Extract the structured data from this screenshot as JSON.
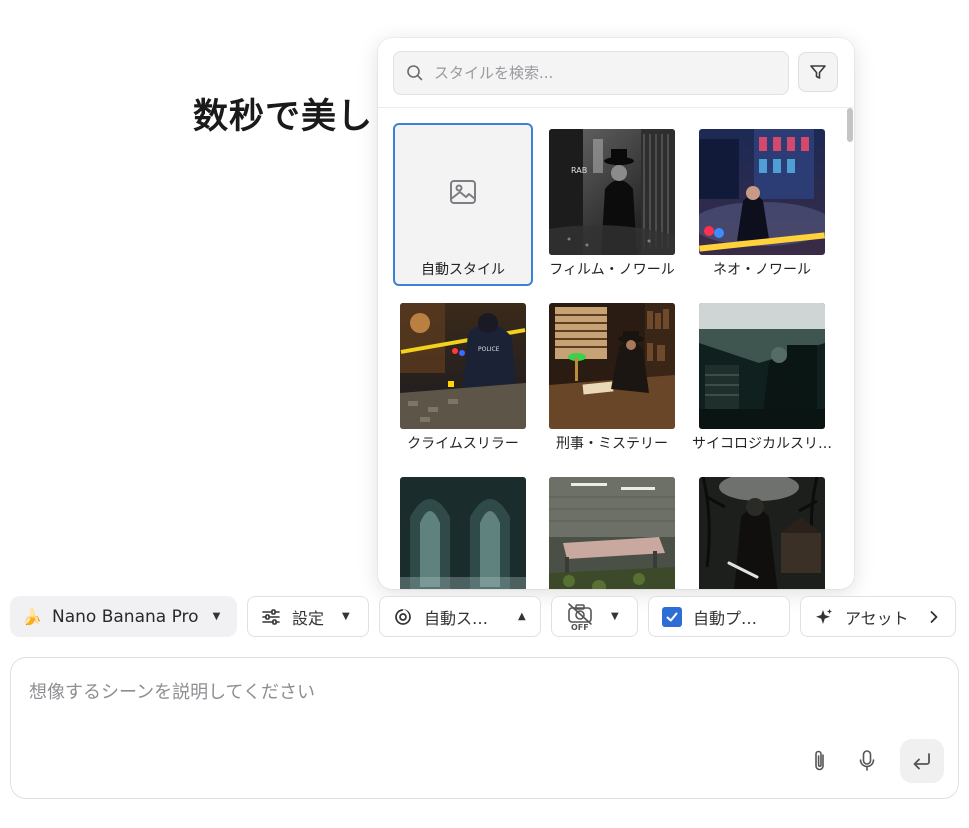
{
  "headline": "数秒で美し",
  "style_picker": {
    "search_placeholder": "スタイルを検索...",
    "icons": {
      "search": "search-icon",
      "filter": "filter-icon",
      "image_placeholder": "image-icon"
    },
    "styles": [
      {
        "label": "自動スタイル",
        "selected": true
      },
      {
        "label": "フィルム・ノワール"
      },
      {
        "label": "ネオ・ノワール"
      },
      {
        "label": "クライムスリラー"
      },
      {
        "label": "刑事・ミステリー"
      },
      {
        "label": "サイコロジカルスリラー"
      },
      {
        "label": ""
      },
      {
        "label": ""
      },
      {
        "label": ""
      }
    ],
    "selected_color": "#3b82d6"
  },
  "toolbar": {
    "model": {
      "emoji": "🍌",
      "label": "Nano Banana Pro"
    },
    "settings": {
      "label": "設定"
    },
    "style": {
      "label": "自動スタイル"
    },
    "camera": {
      "badge": "OFF"
    },
    "auto_prompt": {
      "label": "自動プロンプト",
      "checked": true
    },
    "assets": {
      "label": "アセット"
    }
  },
  "composer": {
    "placeholder": "想像するシーンを説明してください"
  }
}
